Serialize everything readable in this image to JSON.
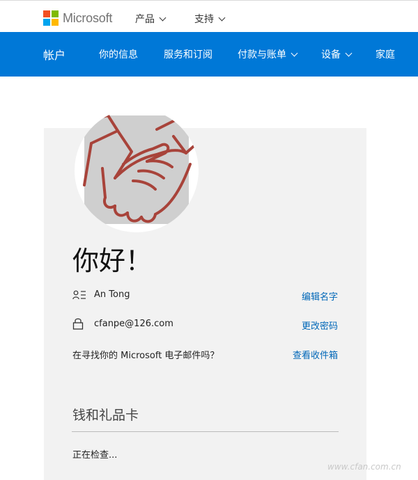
{
  "header": {
    "brand": "Microsoft",
    "brand_colors": [
      "#f25022",
      "#7fba00",
      "#00a4ef",
      "#ffb900"
    ],
    "menu": [
      {
        "label": "产品",
        "has_dropdown": true
      },
      {
        "label": "支持",
        "has_dropdown": true
      }
    ]
  },
  "nav": {
    "title": "帐户",
    "items": [
      {
        "label": "你的信息",
        "has_dropdown": false
      },
      {
        "label": "服务和订阅",
        "has_dropdown": false
      },
      {
        "label": "付款与账单",
        "has_dropdown": true
      },
      {
        "label": "设备",
        "has_dropdown": true
      },
      {
        "label": "家庭",
        "has_dropdown": false
      }
    ],
    "background": "#0078d7"
  },
  "profile": {
    "avatar_icon": "handshake-icon",
    "greeting": "你好！",
    "name": "An Tong",
    "edit_name_link": "编辑名字",
    "email": "cfanpe@126.com",
    "change_password_link": "更改密码",
    "mail_prompt": "在寻找你的 Microsoft 电子邮件吗？",
    "view_inbox_link": "查看收件箱"
  },
  "wallet": {
    "title": "钱和礼品卡",
    "status": "正在检查..."
  },
  "watermark": "www.cfan.com.cn",
  "colors": {
    "link": "#0067b8",
    "card_bg": "#f2f2f2",
    "handshake": "#a8433a"
  }
}
